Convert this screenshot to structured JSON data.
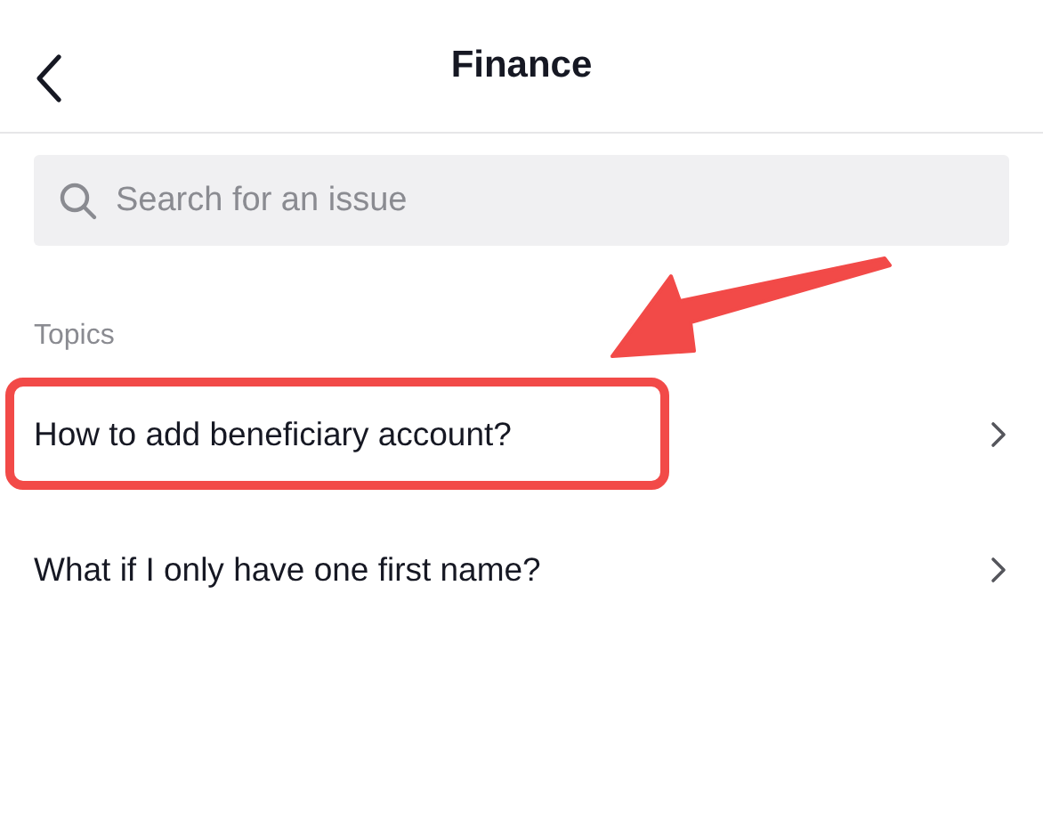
{
  "header": {
    "title": "Finance"
  },
  "search": {
    "placeholder": "Search for an issue"
  },
  "topics": {
    "heading": "Topics",
    "items": [
      {
        "label": "How to add beneficiary account?",
        "highlighted": true
      },
      {
        "label": "What if I only have one first name?",
        "highlighted": false
      }
    ]
  }
}
